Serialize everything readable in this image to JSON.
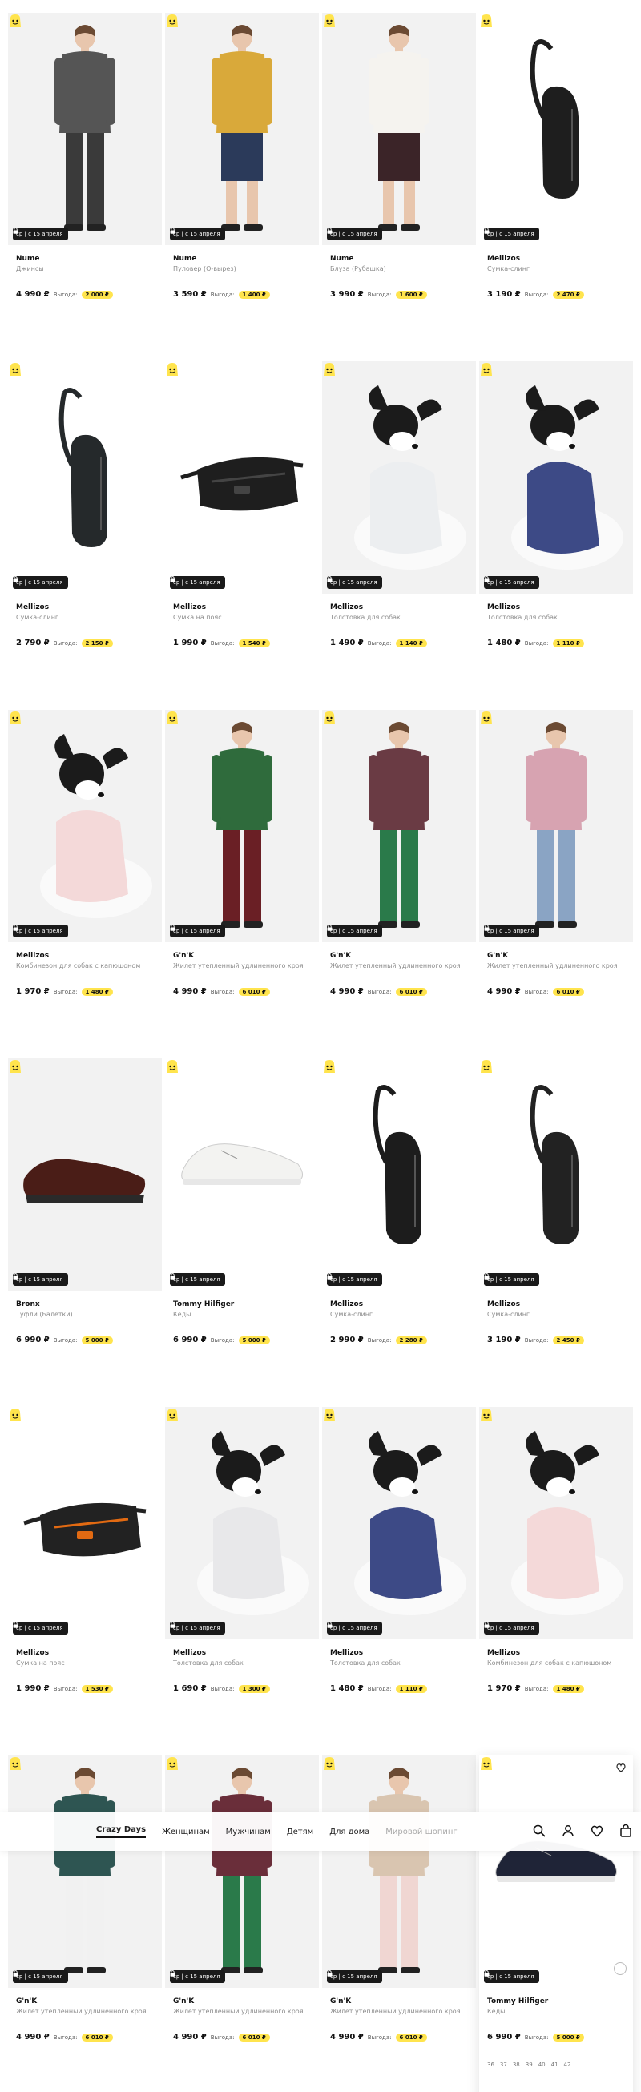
{
  "nav": {
    "items": [
      "Crazy Days",
      "Женщинам",
      "Мужчинам",
      "Детям",
      "Для дома",
      "Мировой шопинг"
    ],
    "icons": [
      "search-icon",
      "user-icon",
      "heart-icon",
      "bag-icon"
    ]
  },
  "badge_text": "ср | с 15 апреля",
  "benefit_label": "Выгода:",
  "colors": {
    "accent": "#ffe44d",
    "badge_bg": "#1a1a1a"
  },
  "products": [
    {
      "brand": "Nume",
      "category": "Джинсы",
      "price": "4 990 ₽",
      "benefit": "2 000 ₽"
    },
    {
      "brand": "Nume",
      "category": "Пуловер (О-вырез)",
      "price": "3 590 ₽",
      "benefit": "1 400 ₽"
    },
    {
      "brand": "Nume",
      "category": "Блуза (Рубашка)",
      "price": "3 990 ₽",
      "benefit": "1 600 ₽"
    },
    {
      "brand": "Mellizos",
      "category": "Сумка-слинг",
      "price": "3 190 ₽",
      "benefit": "2 470 ₽"
    },
    {
      "brand": "Mellizos",
      "category": "Сумка-слинг",
      "price": "2 790 ₽",
      "benefit": "2 150 ₽"
    },
    {
      "brand": "Mellizos",
      "category": "Сумка на пояс",
      "price": "1 990 ₽",
      "benefit": "1 540 ₽"
    },
    {
      "brand": "Mellizos",
      "category": "Толстовка для собак",
      "price": "1 490 ₽",
      "benefit": "1 140 ₽"
    },
    {
      "brand": "Mellizos",
      "category": "Толстовка для собак",
      "price": "1 480 ₽",
      "benefit": "1 110 ₽"
    },
    {
      "brand": "Mellizos",
      "category": "Комбинезон для собак с капюшоном",
      "price": "1 970 ₽",
      "benefit": "1 480 ₽"
    },
    {
      "brand": "G'n'K",
      "category": "Жилет утепленный удлиненного кроя",
      "price": "4 990 ₽",
      "benefit": "6 010 ₽"
    },
    {
      "brand": "G'n'K",
      "category": "Жилет утепленный удлиненного кроя",
      "price": "4 990 ₽",
      "benefit": "6 010 ₽"
    },
    {
      "brand": "G'n'K",
      "category": "Жилет утепленный удлиненного кроя",
      "price": "4 990 ₽",
      "benefit": "6 010 ₽"
    },
    {
      "brand": "Bronx",
      "category": "Туфли (Балетки)",
      "price": "6 990 ₽",
      "benefit": "5 000 ₽"
    },
    {
      "brand": "Tommy Hilfiger",
      "category": "Кеды",
      "price": "6 990 ₽",
      "benefit": "5 000 ₽"
    },
    {
      "brand": "Mellizos",
      "category": "Сумка-слинг",
      "price": "2 990 ₽",
      "benefit": "2 280 ₽"
    },
    {
      "brand": "Mellizos",
      "category": "Сумка-слинг",
      "price": "3 190 ₽",
      "benefit": "2 450 ₽"
    },
    {
      "brand": "Mellizos",
      "category": "Сумка на пояс",
      "price": "1 990 ₽",
      "benefit": "1 530 ₽"
    },
    {
      "brand": "Mellizos",
      "category": "Толстовка для собак",
      "price": "1 690 ₽",
      "benefit": "1 300 ₽"
    },
    {
      "brand": "Mellizos",
      "category": "Толстовка для собак",
      "price": "1 480 ₽",
      "benefit": "1 110 ₽"
    },
    {
      "brand": "Mellizos",
      "category": "Комбинезон для собак с капюшоном",
      "price": "1 970 ₽",
      "benefit": "1 480 ₽"
    },
    {
      "brand": "G'n'K",
      "category": "Жилет утепленный удлиненного кроя",
      "price": "4 990 ₽",
      "benefit": "6 010 ₽"
    },
    {
      "brand": "G'n'K",
      "category": "Жилет утепленный удлиненного кроя",
      "price": "4 990 ₽",
      "benefit": "6 010 ₽"
    },
    {
      "brand": "G'n'K",
      "category": "Жилет утепленный удлиненного кроя",
      "price": "4 990 ₽",
      "benefit": "6 010 ₽"
    },
    {
      "brand": "Tommy Hilfiger",
      "category": "Кеды",
      "price": "6 990 ₽",
      "benefit": "5 000 ₽",
      "sizes": [
        "36",
        "37",
        "38",
        "39",
        "40",
        "41",
        "42"
      ]
    }
  ]
}
